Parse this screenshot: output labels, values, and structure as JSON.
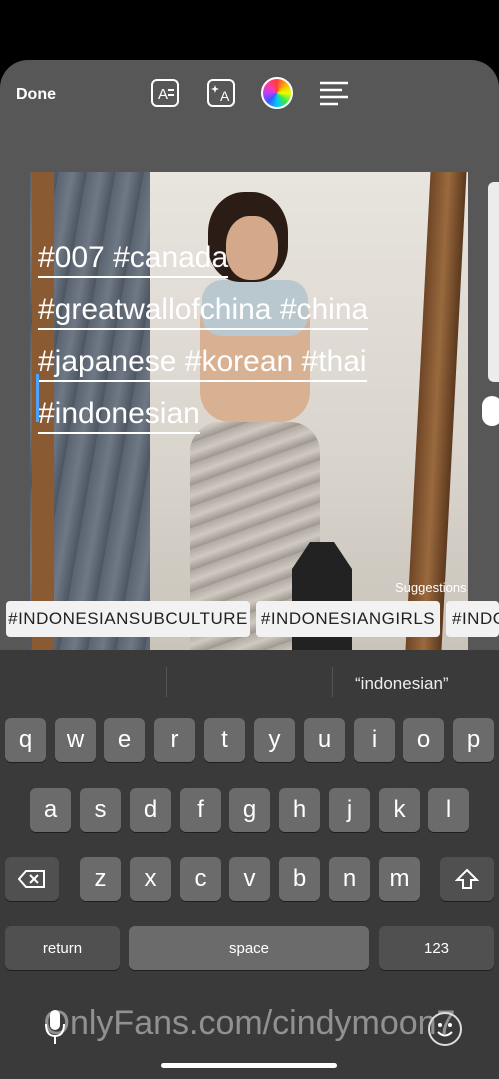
{
  "toolbar": {
    "done_label": "Done"
  },
  "hashtag_text": {
    "line1": "#007 #canada",
    "line2": "#greatwallofchina  #china",
    "line3": "#japanese #korean #thai",
    "line4": "#indonesian"
  },
  "suggestions": {
    "label": "Suggestions",
    "chips": [
      "#INDONESIANSUBCULTURE",
      "#INDONESIANGIRLS",
      "#INDONESIAN"
    ]
  },
  "keyboard": {
    "prediction": "“indonesian”",
    "row1": [
      "q",
      "w",
      "e",
      "r",
      "t",
      "y",
      "u",
      "i",
      "o",
      "p"
    ],
    "row2": [
      "a",
      "s",
      "d",
      "f",
      "g",
      "h",
      "j",
      "k",
      "l"
    ],
    "row3": [
      "z",
      "x",
      "c",
      "v",
      "b",
      "n",
      "m"
    ],
    "numbers_label": "123",
    "space_label": "space",
    "return_label": "return"
  },
  "watermark": "OnlyFans.com/cindymoon7",
  "colors": {
    "panel": "#575757",
    "keyboard": "#3a3a3a",
    "key": "#6b6b6b",
    "caret": "#4aa3ff"
  }
}
